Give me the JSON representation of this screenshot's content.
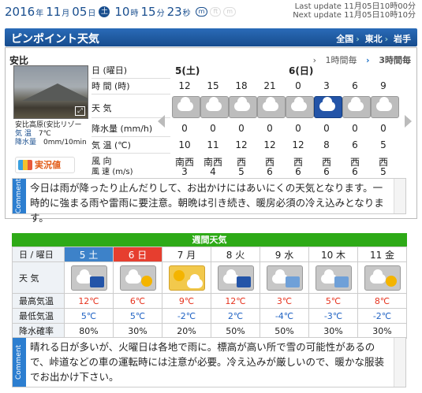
{
  "datetime": {
    "year": "2016",
    "y": "年",
    "month": "11",
    "m": "月",
    "day": "05",
    "d": "日",
    "weekday": "土",
    "hour": "10",
    "h": "時",
    "min": "15",
    "mi": "分",
    "sec": "23",
    "s": "秒"
  },
  "units": [
    "m",
    "ft",
    "m"
  ],
  "update": {
    "last": "Last update  11月05日10時00分",
    "next": "Next update  11月05日10時10分"
  },
  "header": {
    "title": "ピンポイント天気",
    "bc": [
      "全国",
      "東北",
      "岩手"
    ]
  },
  "location": "安比",
  "tabs": [
    "1時間毎",
    "3時間毎"
  ],
  "obs": {
    "name": "安比高原(安比リゾー",
    "temp_label": "気 温",
    "temp": "7℃",
    "snow_label": "降水量",
    "snow": "0mm/10min"
  },
  "jikkyo": "実況値",
  "hourly": {
    "row_day_label": "日 (曜日)",
    "row_day": [
      "5(土)",
      "6(日)"
    ],
    "row_time_label": "時 間 (時)",
    "times": [
      "12",
      "15",
      "18",
      "21",
      "0",
      "3",
      "6",
      "9"
    ],
    "row_weather_label": "天 気",
    "weather": [
      "cloud",
      "cloud",
      "cloud",
      "cloud",
      "cloud",
      "rain",
      "cloud",
      "cloud"
    ],
    "row_precip_label": "降水量 (mm/h)",
    "precip": [
      "0",
      "0",
      "0",
      "0",
      "0",
      "0",
      "0",
      "0"
    ],
    "row_temp_label": "気 温 (℃)",
    "temp": [
      "10",
      "11",
      "12",
      "12",
      "12",
      "8",
      "6",
      "5"
    ],
    "row_wind_label": "風 向",
    "winddir": [
      "南西",
      "南西",
      "西",
      "西",
      "西",
      "西",
      "西",
      "西"
    ],
    "row_speed_label": "風 速 (m/s)",
    "windspeed": [
      "3",
      "4",
      "5",
      "6",
      "6",
      "6",
      "6",
      "5"
    ]
  },
  "comment1": "今日は雨が降ったり止んだりして、お出かけにはあいにくの天気となります。一時的に強まる雨や雷雨に要注意。朝晩は引き続き、暖房必須の冷え込みとなります。",
  "comment_label": "Comment",
  "weekly": {
    "title": "週間天気",
    "day_label": "日 / 曜日",
    "days": [
      "5 土",
      "6 日",
      "7 月",
      "8 火",
      "9 水",
      "10 木",
      "11 金"
    ],
    "weather_label": "天 気",
    "icons": [
      "cloud-rain",
      "cloud-sun",
      "sun-cloud",
      "cloud-rain",
      "cloud-snow",
      "cloud-snow",
      "cloud-sun"
    ],
    "max_label": "最高気温",
    "max": [
      "12℃",
      "6℃",
      "9℃",
      "12℃",
      "3℃",
      "5℃",
      "8℃"
    ],
    "min_label": "最低気温",
    "min": [
      "5℃",
      "5℃",
      "-2℃",
      "2℃",
      "-4℃",
      "-3℃",
      "-2℃"
    ],
    "pop_label": "降水確率",
    "pop": [
      "80%",
      "30%",
      "20%",
      "50%",
      "50%",
      "30%",
      "30%"
    ]
  },
  "comment2": "晴れる日が多いが、火曜日は各地で雨に。標高が高い所で雪の可能性があるので、峠道などの車の運転時には注意が必要。冷え込みが厳しいので、暖かな服装でお出かけ下さい。"
}
